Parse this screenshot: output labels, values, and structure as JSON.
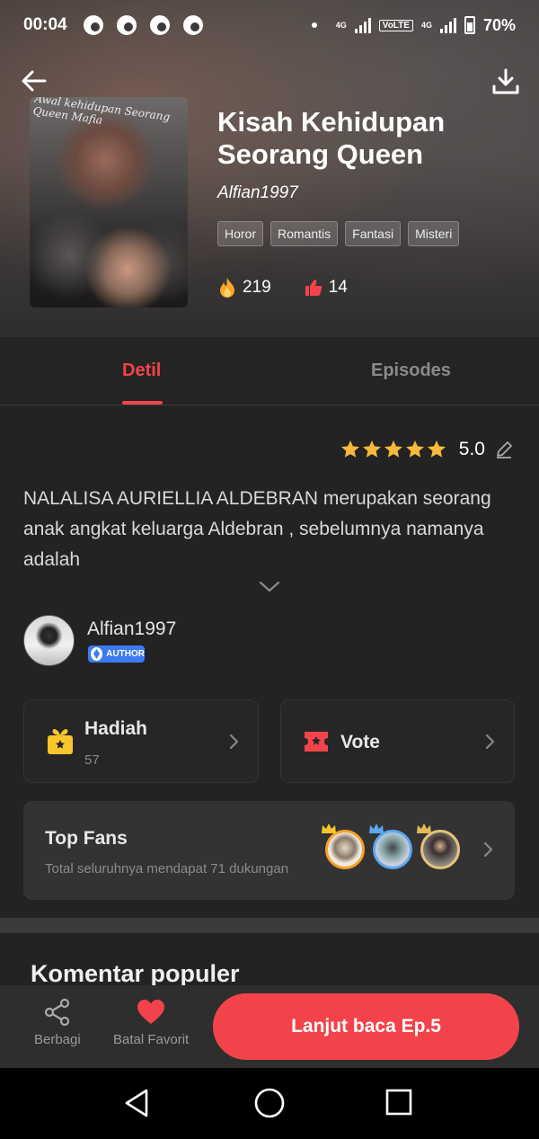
{
  "status_bar": {
    "time": "00:04",
    "network_1": "4G",
    "volte": "VoLTE",
    "network_2": "4G",
    "battery": "70%"
  },
  "book": {
    "title": "Kisah Kehidupan Seorang Queen",
    "cover_text": "Awal kehidupan Seorang Queen Mafia",
    "author": "Alfian1997",
    "tags": [
      "Horor",
      "Romantis",
      "Fantasi",
      "Misteri"
    ],
    "views": "219",
    "likes": "14"
  },
  "tabs": [
    {
      "label": "Detil",
      "active": true
    },
    {
      "label": "Episodes",
      "active": false
    }
  ],
  "rating": {
    "score": "5.0",
    "stars": 5
  },
  "synopsis": "NALALISA AURIELLIA ALDEBRAN merupakan seorang anak angkat keluarga Aldebran , sebelumnya namanya adalah",
  "author_info": {
    "name": "Alfian1997",
    "badge": "AUTHOR"
  },
  "gift_card": {
    "label": "Hadiah",
    "count": "57"
  },
  "vote_card": {
    "label": "Vote"
  },
  "top_fans": {
    "title": "Top Fans",
    "subtitle": "Total seluruhnya mendapat 71 dukungan"
  },
  "comments": {
    "heading": "Komentar populer"
  },
  "actions": {
    "share_label": "Berbagi",
    "favorite_label": "Batal Favorit",
    "read_button": "Lanjut baca Ep.5"
  },
  "colors": {
    "accent": "#f2434a",
    "background": "#232323",
    "star": "#f6b93b",
    "gift": "#f8c62b"
  }
}
